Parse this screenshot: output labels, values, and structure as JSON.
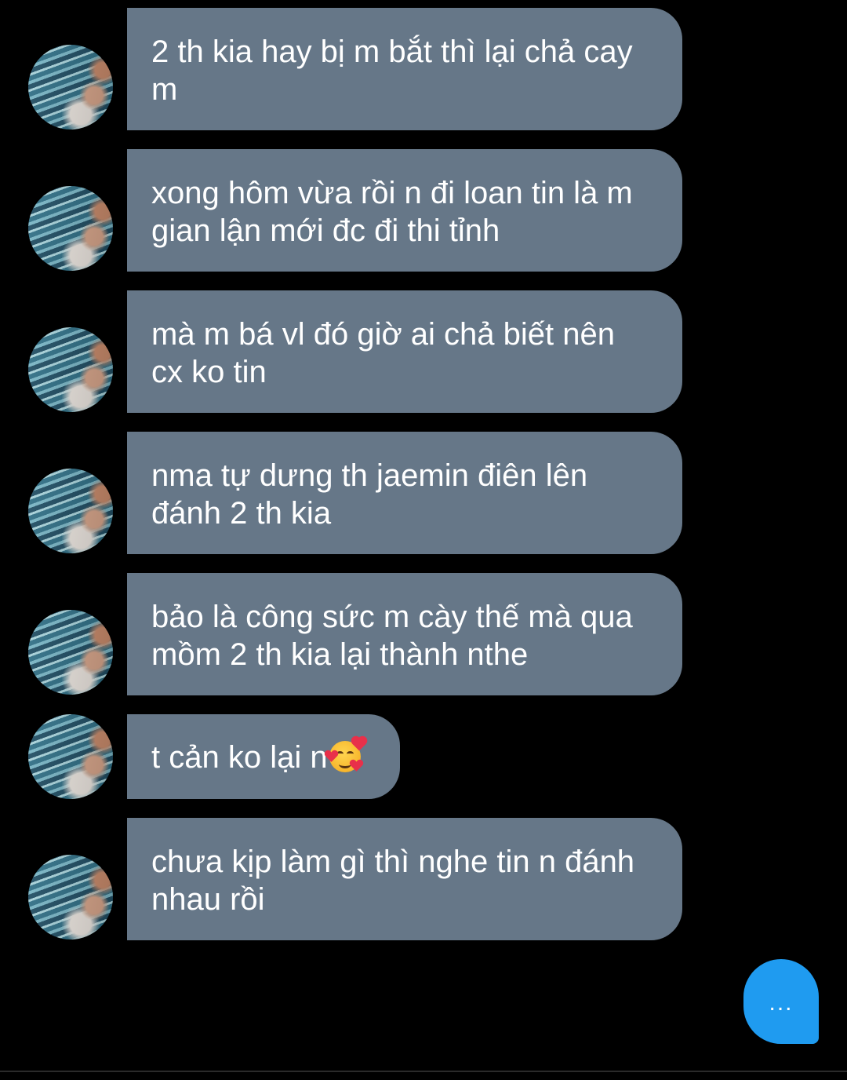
{
  "conversation": {
    "messages": [
      {
        "text": "2 th kia hay bị m bắt thì lại chả cay\nm"
      },
      {
        "text": "xong hôm vừa rồi n đi loan tin là m\ngian lận mới đc đi thi tỉnh"
      },
      {
        "text": "mà m bá vl đó giờ ai chả biết nên\ncx ko tin"
      },
      {
        "text": "nma tự dưng th jaemin điên lên\nđánh 2 th kia"
      },
      {
        "text": "bảo là công sức m cày thế mà qua\nmồm 2 th kia lại thành nthe"
      },
      {
        "text": "t cản ko lại n",
        "emoji": "smiling-face-with-hearts"
      },
      {
        "text": "chưa kịp làm gì thì nghe tin n đánh\nnhau rồi"
      }
    ],
    "typing_indicator": "..."
  },
  "colors": {
    "background": "#000000",
    "bubble": "#667788",
    "bubble_text": "#ffffff",
    "typing_bubble": "#1f9bf0"
  }
}
